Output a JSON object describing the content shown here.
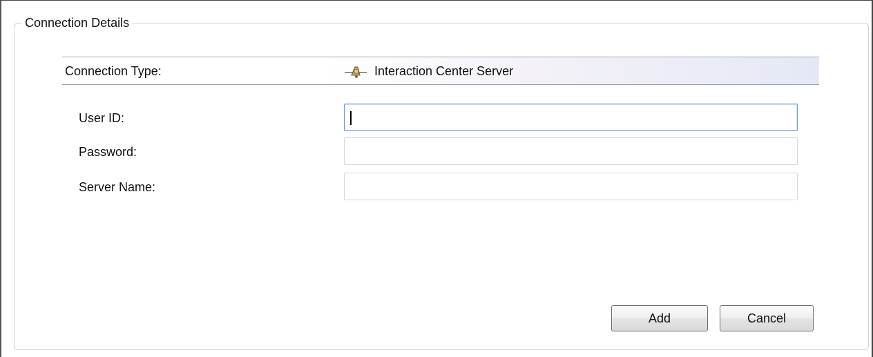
{
  "group": {
    "title": "Connection Details"
  },
  "connection_type": {
    "label": "Connection Type:",
    "value": "Interaction Center Server",
    "icon": "server-connection-icon"
  },
  "fields": {
    "user_id": {
      "label": "User ID:",
      "value": "",
      "focused": true
    },
    "password": {
      "label": "Password:",
      "value": ""
    },
    "server_name": {
      "label": "Server Name:",
      "value": ""
    }
  },
  "buttons": {
    "add_label": "Add",
    "cancel_label": "Cancel"
  },
  "colors": {
    "group_border": "#c9d2dc",
    "focus_border": "#6f9ccd",
    "type_row_gradient_end": "#e4e8f6"
  }
}
